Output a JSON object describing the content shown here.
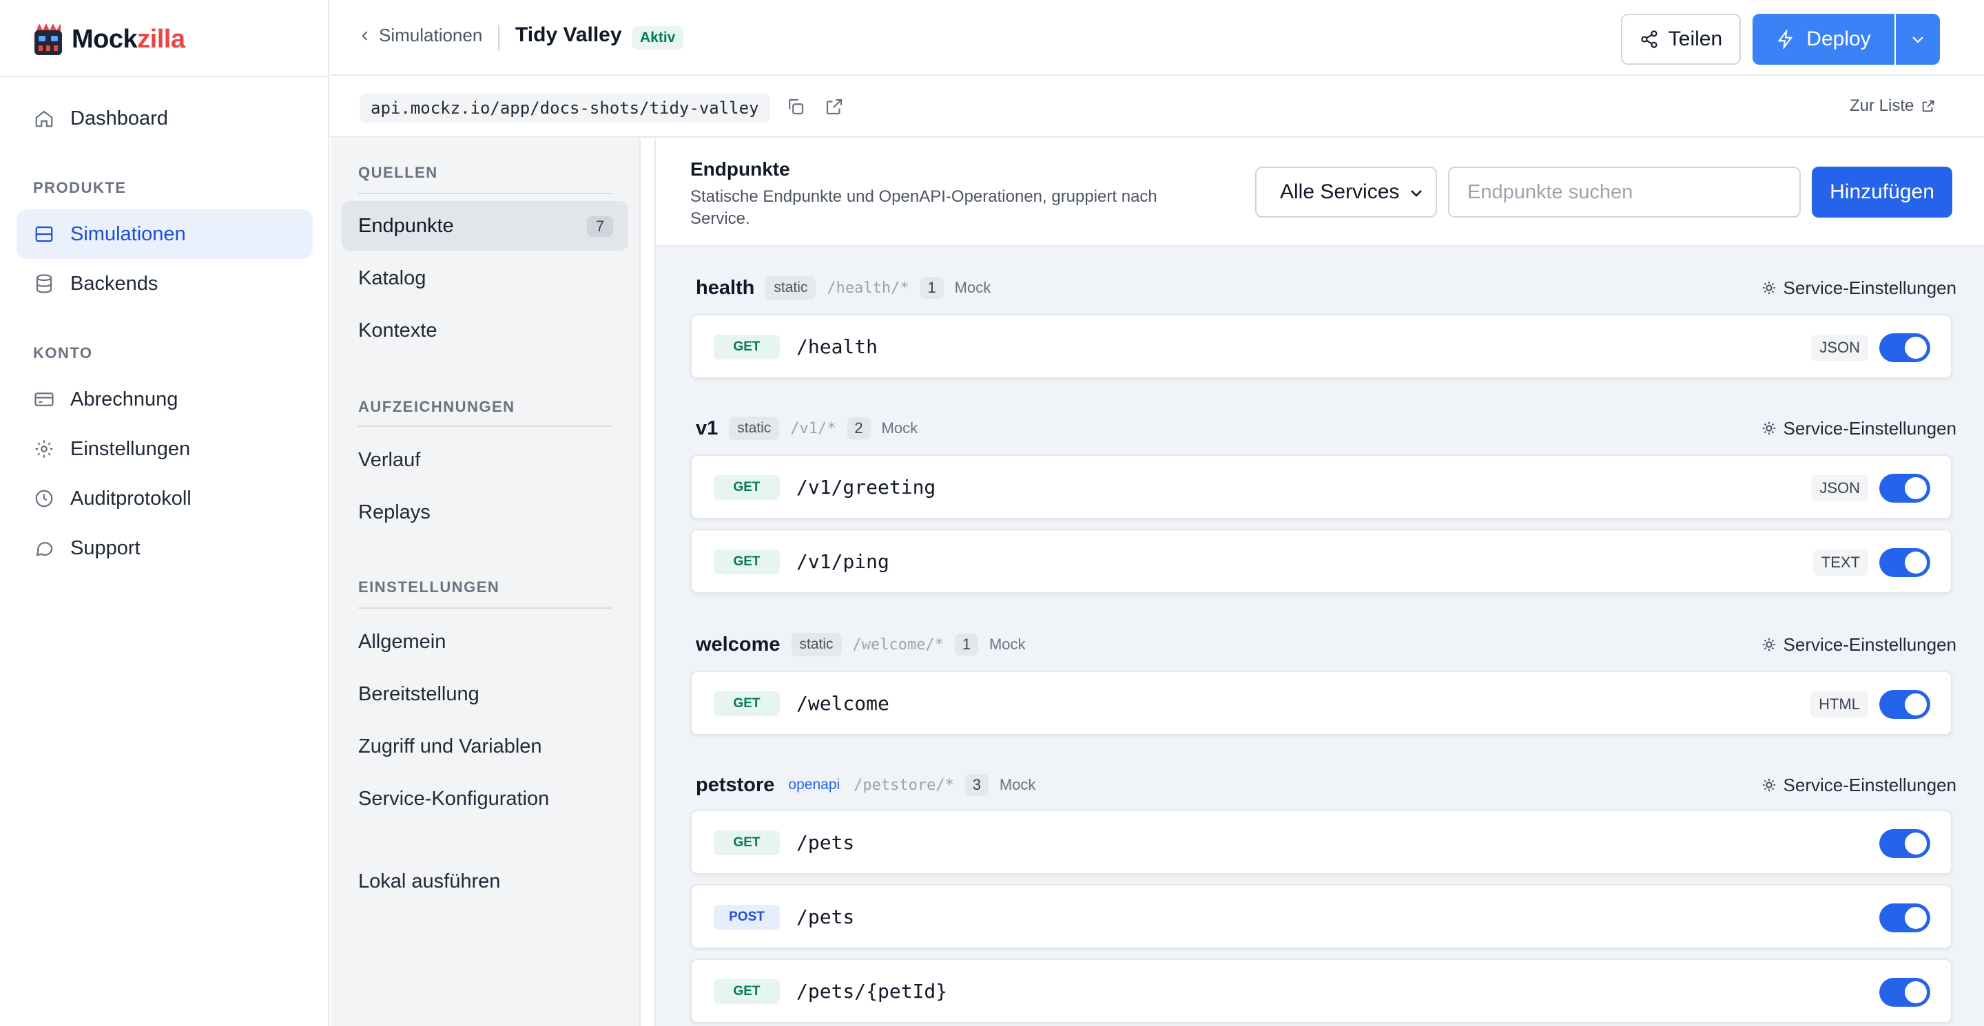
{
  "app": {
    "brand_part1": "Mock",
    "brand_part2": "zilla"
  },
  "sidebar": {
    "items": [
      {
        "label": "Dashboard",
        "icon": "home-icon"
      },
      {
        "label": "Simulationen",
        "icon": "layout-icon",
        "active": true
      },
      {
        "label": "Backends",
        "icon": "database-icon"
      },
      {
        "label": "Abrechnung",
        "icon": "credit-card-icon"
      },
      {
        "label": "Einstellungen",
        "icon": "gear-icon"
      },
      {
        "label": "Auditprotokoll",
        "icon": "clock-icon"
      },
      {
        "label": "Support",
        "icon": "chat-icon"
      }
    ],
    "sections": {
      "produkte": "PRODUKTE",
      "konto": "KONTO"
    }
  },
  "header": {
    "back_label": "Simulationen",
    "title": "Tidy Valley",
    "status": "Aktiv",
    "share_label": "Teilen",
    "deploy_label": "Deploy"
  },
  "urlbar": {
    "url": "api.mockz.io/app/docs-shots/tidy-valley",
    "to_list_label": "Zur Liste"
  },
  "subnav": {
    "sections": {
      "quellen": "QUELLEN",
      "aufzeichnungen": "AUFZEICHNUNGEN",
      "einstellungen": "EINSTELLUNGEN"
    },
    "items": [
      {
        "label": "Endpunkte",
        "count": "7",
        "active": true
      },
      {
        "label": "Katalog"
      },
      {
        "label": "Kontexte"
      },
      {
        "label": "Verlauf"
      },
      {
        "label": "Replays"
      },
      {
        "label": "Allgemein"
      },
      {
        "label": "Bereitstellung"
      },
      {
        "label": "Zugriff und Variablen"
      },
      {
        "label": "Service-Konfiguration"
      },
      {
        "label": "Lokal ausführen"
      }
    ]
  },
  "main": {
    "title": "Endpunkte",
    "description": "Statische Endpunkte und OpenAPI-Operationen, gruppiert nach Service.",
    "service_filter": "Alle Services",
    "search_placeholder": "Endpunkte suchen",
    "add_label": "Hinzufügen",
    "service_settings_label": "Service-Einstellungen",
    "groups": [
      {
        "name": "health",
        "type": "static",
        "prefix": "/health/*",
        "count": "1",
        "mode": "Mock",
        "endpoints": [
          {
            "method": "GET",
            "path": "/health",
            "format": "JSON",
            "enabled": true
          }
        ]
      },
      {
        "name": "v1",
        "type": "static",
        "prefix": "/v1/*",
        "count": "2",
        "mode": "Mock",
        "endpoints": [
          {
            "method": "GET",
            "path": "/v1/greeting",
            "format": "JSON",
            "enabled": true
          },
          {
            "method": "GET",
            "path": "/v1/ping",
            "format": "TEXT",
            "enabled": true
          }
        ]
      },
      {
        "name": "welcome",
        "type": "static",
        "prefix": "/welcome/*",
        "count": "1",
        "mode": "Mock",
        "endpoints": [
          {
            "method": "GET",
            "path": "/welcome",
            "format": "HTML",
            "enabled": true
          }
        ]
      },
      {
        "name": "petstore",
        "type": "openapi",
        "prefix": "/petstore/*",
        "count": "3",
        "mode": "Mock",
        "endpoints": [
          {
            "method": "GET",
            "path": "/pets",
            "enabled": true
          },
          {
            "method": "POST",
            "path": "/pets",
            "enabled": true
          },
          {
            "method": "GET",
            "path": "/pets/{petId}",
            "enabled": true
          }
        ]
      }
    ]
  },
  "colors": {
    "accent": "#2563eb",
    "brand_red": "#ef4444",
    "active_nav_bg": "#eaf1fd",
    "status_green": "#047857"
  }
}
